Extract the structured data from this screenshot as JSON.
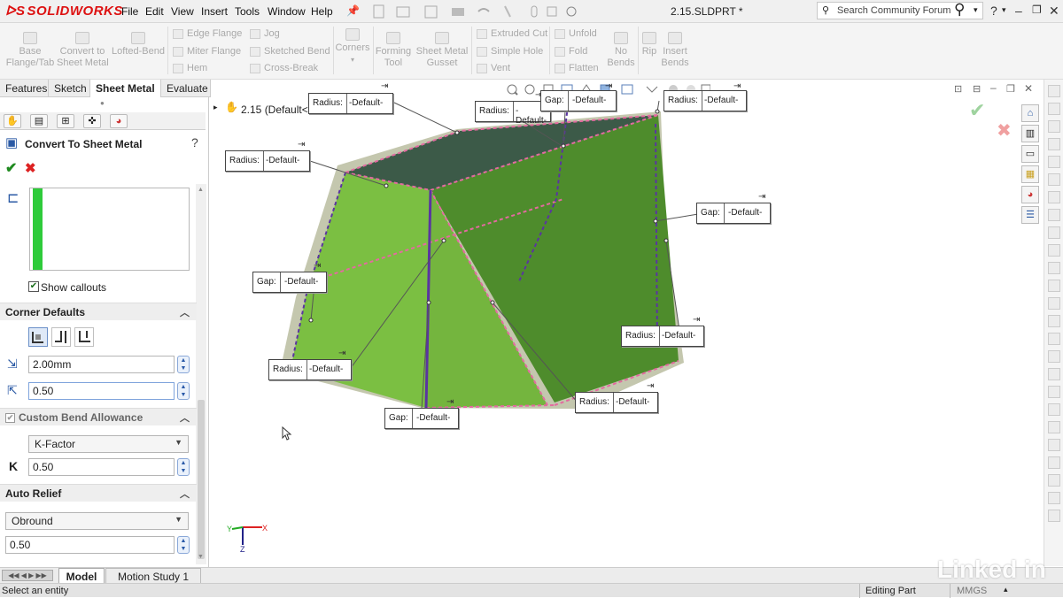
{
  "app": {
    "name": "SOLIDWORKS",
    "document_title": "2.15.SLDPRT *"
  },
  "menu": [
    "File",
    "Edit",
    "View",
    "Insert",
    "Tools",
    "Window",
    "Help"
  ],
  "search": {
    "placeholder": "Search Community Forum"
  },
  "command_manager": {
    "big": [
      {
        "label": "Base\nFlange/Tab"
      },
      {
        "label": "Convert to\nSheet Metal"
      },
      {
        "label": "Lofted-Bend"
      },
      {
        "label": "Corners"
      },
      {
        "label": "Forming\nTool"
      },
      {
        "label": "Sheet Metal\nGusset"
      },
      {
        "label": "No\nBends"
      },
      {
        "label": "Rip"
      },
      {
        "label": "Insert\nBends"
      }
    ],
    "small_col1": [
      "Edge Flange",
      "Miter Flange",
      "Hem"
    ],
    "small_col2": [
      "Jog",
      "Sketched Bend",
      "Cross-Break"
    ],
    "small_col3": [
      "Extruded Cut",
      "Simple Hole",
      "Vent"
    ],
    "small_col4": [
      "Unfold",
      "Fold",
      "Flatten"
    ]
  },
  "tabs": [
    {
      "label": "Features",
      "active": false
    },
    {
      "label": "Sketch",
      "active": false
    },
    {
      "label": "Sheet Metal",
      "active": true
    },
    {
      "label": "Evaluate",
      "active": false
    }
  ],
  "feature": {
    "title": "Convert To Sheet Metal",
    "help": "?",
    "show_callouts": "Show callouts",
    "corner_defaults": "Corner Defaults",
    "gap_value": "2.00mm",
    "ratio_value": "0.50",
    "custom_bend_allowance": "Custom Bend Allowance",
    "bend_type": "K-Factor",
    "k_label": "K",
    "k_value": "0.50",
    "auto_relief": "Auto Relief",
    "relief_type": "Obround",
    "relief_value": "0.50"
  },
  "tree": {
    "root": "2.15  (Default<<Def..."
  },
  "callouts": [
    {
      "key": "Radius:",
      "value": "-Default-"
    },
    {
      "key": "Radius:",
      "value": "-Default-"
    },
    {
      "key": "Gap:",
      "value": "-Default-"
    },
    {
      "key": "Radius:",
      "value": "-Default-"
    },
    {
      "key": "Radius:",
      "value": "-Default-"
    },
    {
      "key": "Gap:",
      "value": "-Default-"
    },
    {
      "key": "Gap:",
      "value": "-Default-"
    },
    {
      "key": "Radius:",
      "value": "-Default-"
    },
    {
      "key": "Radius:",
      "value": "-Default-"
    },
    {
      "key": "Radius:",
      "value": "-Default-"
    },
    {
      "key": "Gap:",
      "value": "-Default-"
    }
  ],
  "triad": {
    "x": "X",
    "y": "Y",
    "z": "Z"
  },
  "bottom_tabs": [
    {
      "label": "Model",
      "active": true
    },
    {
      "label": "Motion Study 1",
      "active": false
    }
  ],
  "status": {
    "message": "Select an entity",
    "mode": "Editing Part",
    "units": "MMGS",
    "watermark": "Linked in"
  },
  "colors": {
    "accent_red": "#dd1111",
    "face_light": "#7bbf42",
    "face_dark": "#4e8c2c",
    "top_face": "#3c5a48",
    "seam": "#e46aa0",
    "bend_line": "#5a35a0"
  }
}
